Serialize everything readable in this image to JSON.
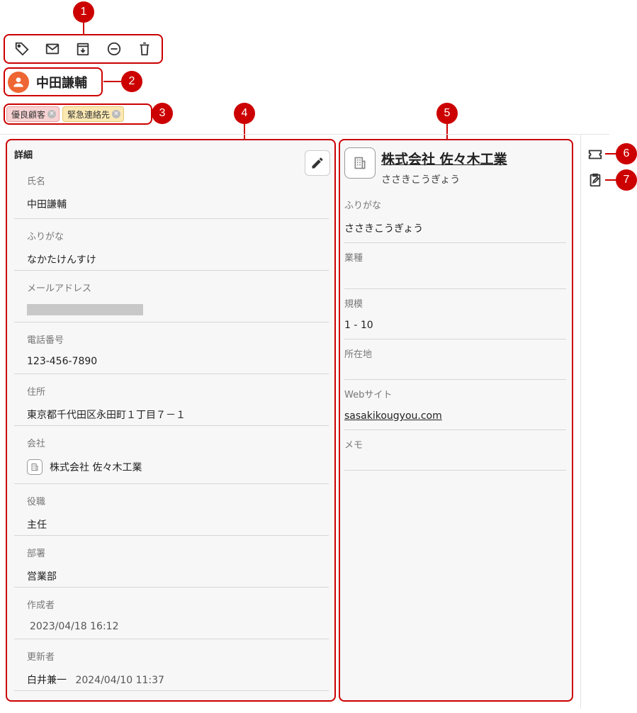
{
  "callouts": [
    "1",
    "2",
    "3",
    "4",
    "5",
    "6",
    "7"
  ],
  "toolbar": {
    "icons": [
      "tag-icon",
      "mail-icon",
      "archive-icon",
      "block-icon",
      "trash-icon"
    ]
  },
  "contact": {
    "name": "中田謙輔",
    "avatar_color": "#ee6633"
  },
  "tags": [
    {
      "label": "優良顧客",
      "color": "#f9d3d3"
    },
    {
      "label": "緊急連絡先",
      "color": "#fbe8b2"
    }
  ],
  "detail": {
    "title": "詳細",
    "fields": [
      {
        "label": "氏名",
        "value": "中田謙輔"
      },
      {
        "label": "ふりがな",
        "value": "なかたけんすけ"
      },
      {
        "label": "メールアドレス",
        "value": ""
      },
      {
        "label": "電話番号",
        "value": "123-456-7890"
      },
      {
        "label": "住所",
        "value": "東京都千代田区永田町１丁目７－１"
      },
      {
        "label": "会社",
        "value": "株式会社 佐々木工業"
      },
      {
        "label": "役職",
        "value": "主任"
      },
      {
        "label": "部署",
        "value": "営業部"
      },
      {
        "label": "作成者",
        "value": "2023/04/18 16:12"
      },
      {
        "label": "更新者",
        "value": "白井兼一",
        "date": "2024/04/10 11:37"
      }
    ]
  },
  "company": {
    "name": "株式会社 佐々木工業",
    "kana": "ささきこうぎょう",
    "fields": [
      {
        "label": "ふりがな",
        "value": "ささきこうぎょう"
      },
      {
        "label": "業種",
        "value": ""
      },
      {
        "label": "規模",
        "value": "1 - 10"
      },
      {
        "label": "所在地",
        "value": ""
      },
      {
        "label": "Webサイト",
        "value": "sasakikougyou.com"
      },
      {
        "label": "メモ",
        "value": ""
      }
    ]
  },
  "accent_color": "#cc0000"
}
